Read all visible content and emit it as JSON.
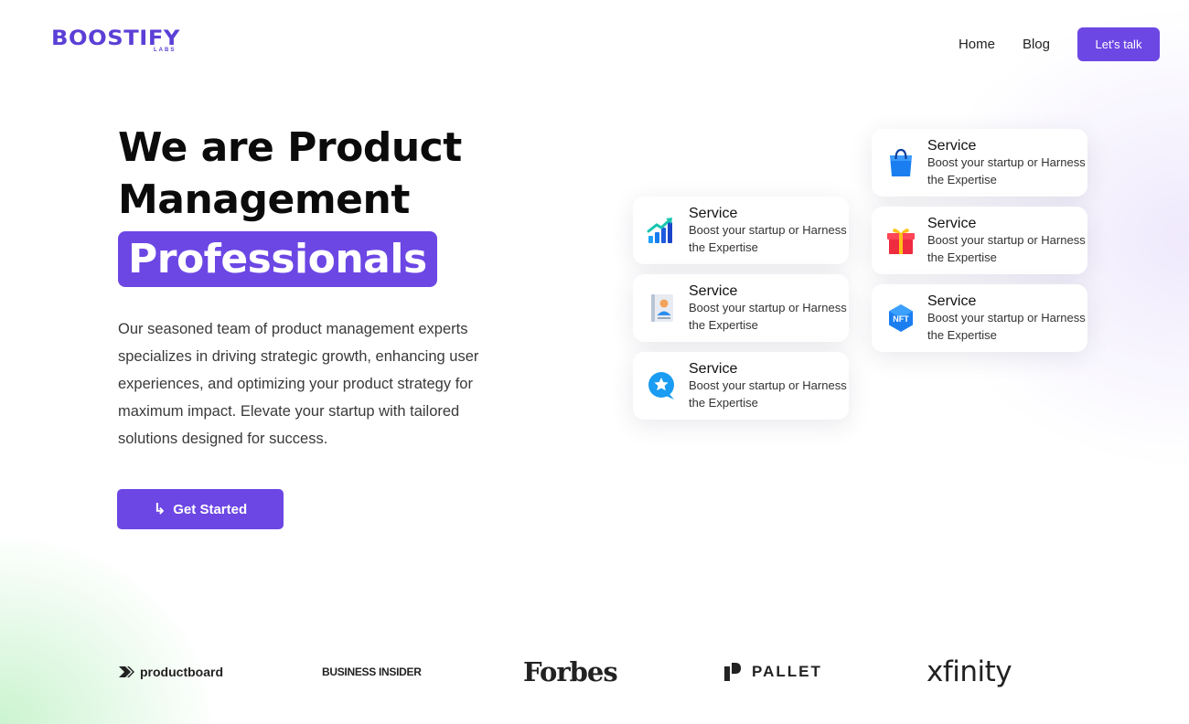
{
  "brand": {
    "logo_text": "BOOSTIFY",
    "logo_sub": "LABS",
    "accent": "#6c47e4"
  },
  "nav": {
    "links": [
      "Home",
      "Blog"
    ],
    "cta_label": "Let's talk"
  },
  "hero": {
    "title": "We are Product Management",
    "highlight": "Professionals",
    "description": "Our seasoned team of product management experts specializes in driving strategic growth, enhancing user experiences, and optimizing your product strategy for maximum impact. Elevate your startup with tailored solutions designed for success.",
    "button_label": "Get Started"
  },
  "services": [
    {
      "icon": "growth-chart-icon",
      "title": "Service",
      "desc": "Boost your startup or Harness the Expertise"
    },
    {
      "icon": "profile-book-icon",
      "title": "Service",
      "desc": "Boost your startup or Harness the Expertise"
    },
    {
      "icon": "chat-star-icon",
      "title": "Service",
      "desc": "Boost your startup or Harness the Expertise"
    },
    {
      "icon": "shopping-bag-icon",
      "title": "Service",
      "desc": "Boost your startup or Harness the Expertise"
    },
    {
      "icon": "gift-icon",
      "title": "Service",
      "desc": "Boost your startup or Harness the Expertise"
    },
    {
      "icon": "nft-icon",
      "title": "Service",
      "desc": "Boost your startup or Harness the Expertise",
      "icon_text": "NFT"
    }
  ],
  "partners": [
    "productboard",
    "BUSINESS INSIDER",
    "Forbes",
    "PALLET",
    "xfinity"
  ]
}
